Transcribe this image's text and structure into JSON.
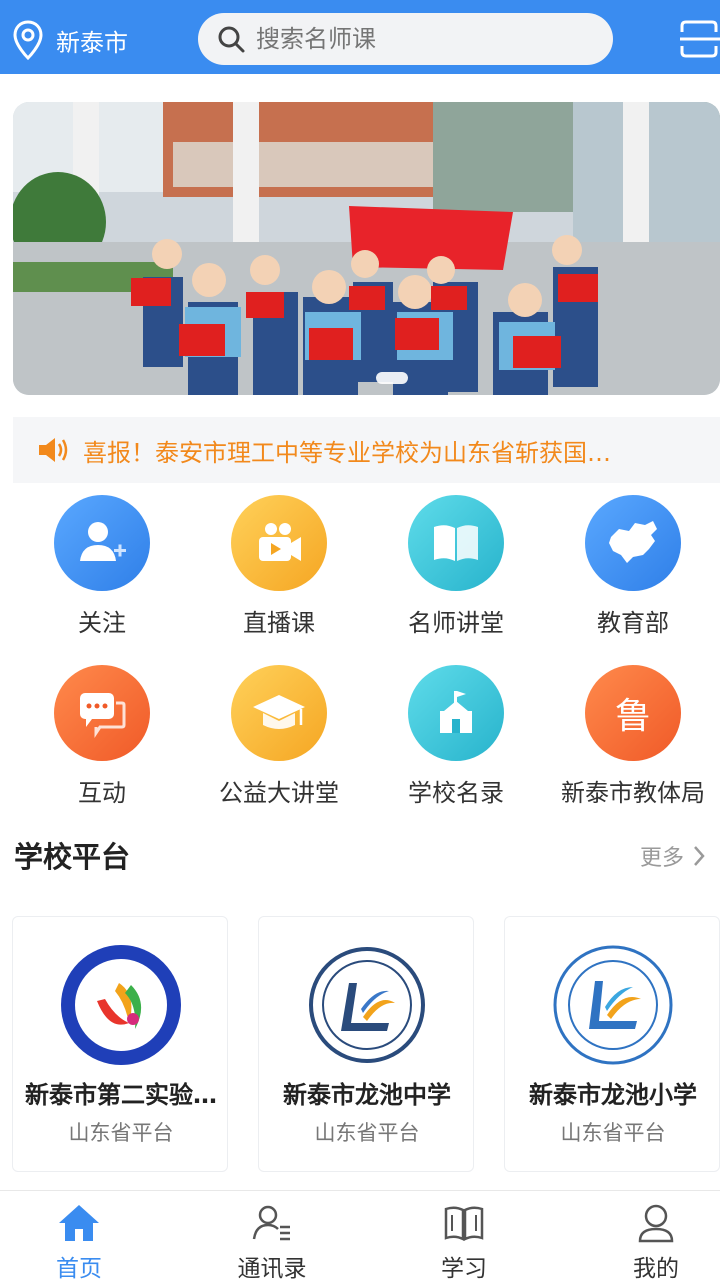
{
  "header": {
    "city": "新泰市",
    "search_placeholder": "搜索名师课",
    "accent_color": "#3a8cf0"
  },
  "banner": {
    "icons": [
      "banner-photo"
    ],
    "pages": 1,
    "active_page": 1
  },
  "notice": {
    "text": "喜报！泰安市理工中等专业学校为山东省斩获国…",
    "color": "#f2891c"
  },
  "grid": {
    "items": [
      {
        "label": "关注",
        "icon": "user-plus-icon",
        "color": "#3d8ff5"
      },
      {
        "label": "直播课",
        "icon": "video-camera-icon",
        "color": "#f7b733"
      },
      {
        "label": "名师讲堂",
        "icon": "open-book-icon",
        "color": "#3cc6d9"
      },
      {
        "label": "教育部",
        "icon": "china-map-icon",
        "color": "#3d8ff5"
      },
      {
        "label": "互动",
        "icon": "chat-bubbles-icon",
        "color": "#f5713a"
      },
      {
        "label": "公益大讲堂",
        "icon": "graduation-cap-icon",
        "color": "#f7b733"
      },
      {
        "label": "学校名录",
        "icon": "school-building-icon",
        "color": "#3cc6d9"
      },
      {
        "label": "新泰市教体局",
        "icon": "lu-character-icon",
        "glyph": "鲁",
        "color": "#f5713a"
      }
    ]
  },
  "school_section": {
    "title": "学校平台",
    "more": "更多",
    "cards": [
      {
        "name": "新泰市第二实验…",
        "sub": "山东省平台"
      },
      {
        "name": "新泰市龙池中学",
        "sub": "山东省平台"
      },
      {
        "name": "新泰市龙池小学",
        "sub": "山东省平台"
      }
    ]
  },
  "tabbar": {
    "items": [
      {
        "label": "首页",
        "icon": "home-icon",
        "active": true
      },
      {
        "label": "通讯录",
        "icon": "contacts-icon",
        "active": false
      },
      {
        "label": "学习",
        "icon": "book-icon",
        "active": false
      },
      {
        "label": "我的",
        "icon": "profile-icon",
        "active": false
      }
    ]
  }
}
